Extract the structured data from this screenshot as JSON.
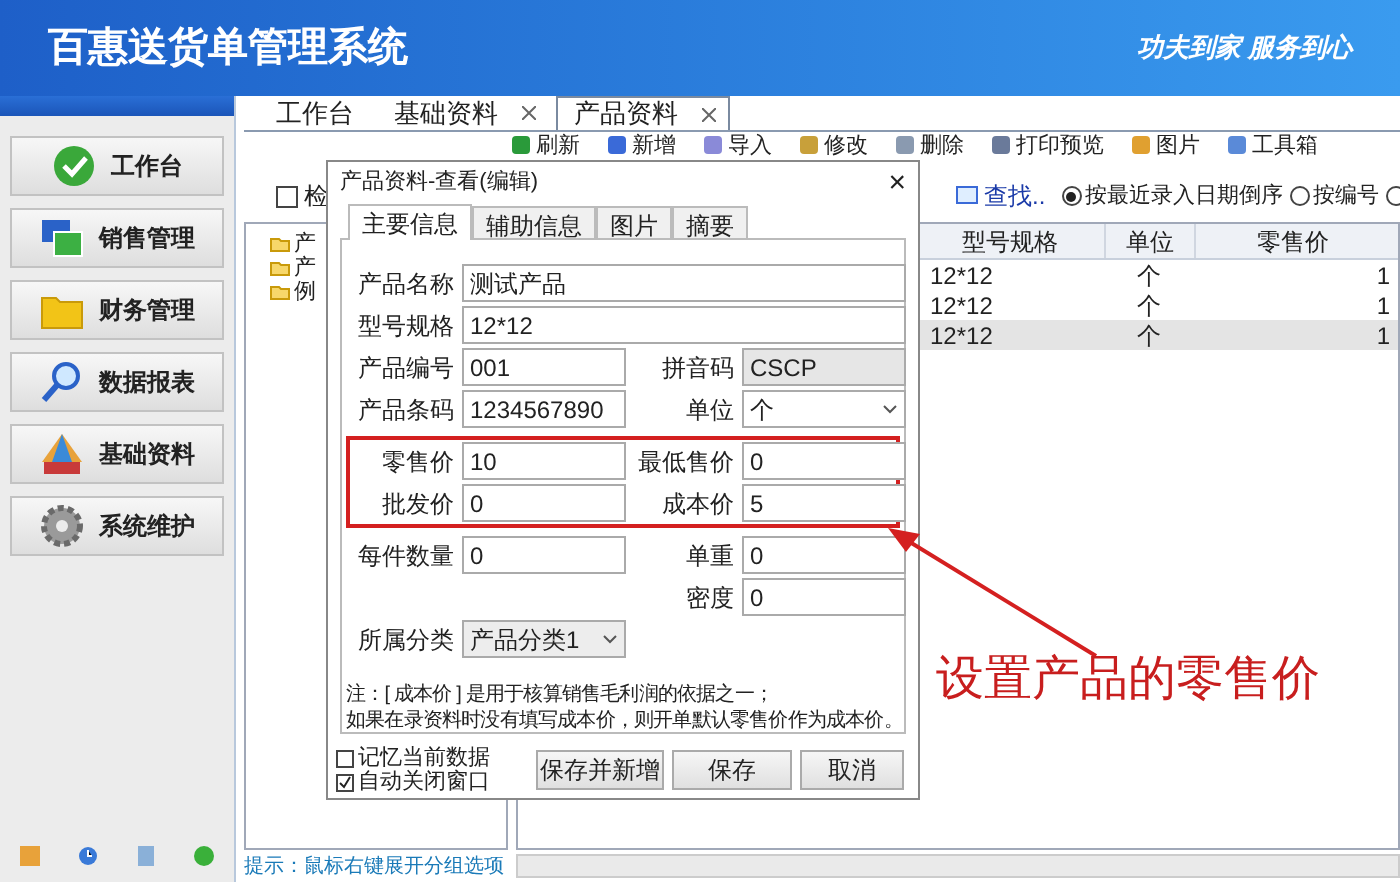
{
  "header": {
    "title": "百惠送货单管理系统",
    "slogan": "功夫到家 服务到心"
  },
  "sidebar": {
    "items": [
      {
        "label": "工作台"
      },
      {
        "label": "销售管理"
      },
      {
        "label": "财务管理"
      },
      {
        "label": "数据报表"
      },
      {
        "label": "基础资料"
      },
      {
        "label": "系统维护"
      }
    ]
  },
  "tabs": [
    {
      "label": "工作台",
      "closable": false,
      "selected": false
    },
    {
      "label": "基础资料",
      "closable": true,
      "selected": false
    },
    {
      "label": "产品资料",
      "closable": true,
      "selected": true
    }
  ],
  "toolbar": [
    "刷新",
    "新增",
    "导入",
    "修改",
    "删除",
    "打印预览",
    "图片",
    "工具箱"
  ],
  "filter": {
    "checkbox_label": "检",
    "checked": false,
    "find": "查找..",
    "sort_options": [
      {
        "label": "按最近录入日期倒序",
        "selected": true
      },
      {
        "label": "按编号",
        "selected": false
      },
      {
        "selected": false
      }
    ]
  },
  "tree": {
    "items": [
      "产",
      "产",
      "例"
    ]
  },
  "table": {
    "columns": [
      "型号规格",
      "单位",
      "零售价"
    ],
    "rows": [
      {
        "cells": [
          "12*12",
          "个",
          "1"
        ],
        "selected": false
      },
      {
        "cells": [
          "12*12",
          "个",
          "1"
        ],
        "selected": false
      },
      {
        "cells": [
          "12*12",
          "个",
          "1"
        ],
        "selected": true
      }
    ]
  },
  "status_hint": "提示：鼠标右键展开分组选项",
  "dialog": {
    "title": "产品资料-查看(编辑)",
    "close": "×",
    "tabs": [
      {
        "label": "主要信息",
        "selected": true
      },
      {
        "label": "辅助信息",
        "selected": false
      },
      {
        "label": "图片",
        "selected": false
      },
      {
        "label": "摘要",
        "selected": false
      }
    ],
    "sections": [
      {
        "highlighted": false,
        "rows": [
          {
            "wide": {
              "label": "产品名称",
              "value": "测试产品"
            }
          },
          {
            "wide": {
              "label": "型号规格",
              "value": "12*12"
            }
          },
          {
            "left": {
              "label": "产品编号",
              "value": "001",
              "kind": "text"
            },
            "right": {
              "label": "拼音码",
              "value": "CSCP",
              "kind": "readonly"
            }
          },
          {
            "left": {
              "label": "产品条码",
              "value": "1234567890",
              "kind": "text"
            },
            "right": {
              "label": "单位",
              "value": "个",
              "kind": "select"
            }
          }
        ]
      },
      {
        "highlighted": true,
        "rows": [
          {
            "left": {
              "label": "零售价",
              "value": "10",
              "kind": "text"
            },
            "right": {
              "label": "最低售价",
              "value": "0",
              "kind": "text"
            }
          },
          {
            "left": {
              "label": "批发价",
              "value": "0",
              "kind": "text"
            },
            "right": {
              "label": "成本价",
              "value": "5",
              "kind": "text"
            }
          }
        ]
      },
      {
        "highlighted": false,
        "rows": [
          {
            "left": {
              "label": "每件数量",
              "value": "0",
              "kind": "text"
            },
            "right": {
              "label": "单重",
              "value": "0",
              "kind": "text"
            }
          },
          {
            "right": {
              "label": "密度",
              "value": "0",
              "kind": "text"
            }
          },
          {
            "left": {
              "label": "所属分类",
              "value": "产品分类1",
              "kind": "select"
            }
          }
        ]
      }
    ],
    "notes": [
      "注：[ 成本价 ] 是用于核算销售毛利润的依据之一；",
      "如果在录资料时没有填写成本价，则开单默认零售价作为成本价。"
    ],
    "options": [
      {
        "label": "记忆当前数据",
        "checked": false
      },
      {
        "label": "自动关闭窗口",
        "checked": true
      }
    ],
    "buttons": [
      "保存并新增",
      "保存",
      "取消"
    ]
  },
  "annotation": {
    "text": "设置产品的零售价"
  }
}
